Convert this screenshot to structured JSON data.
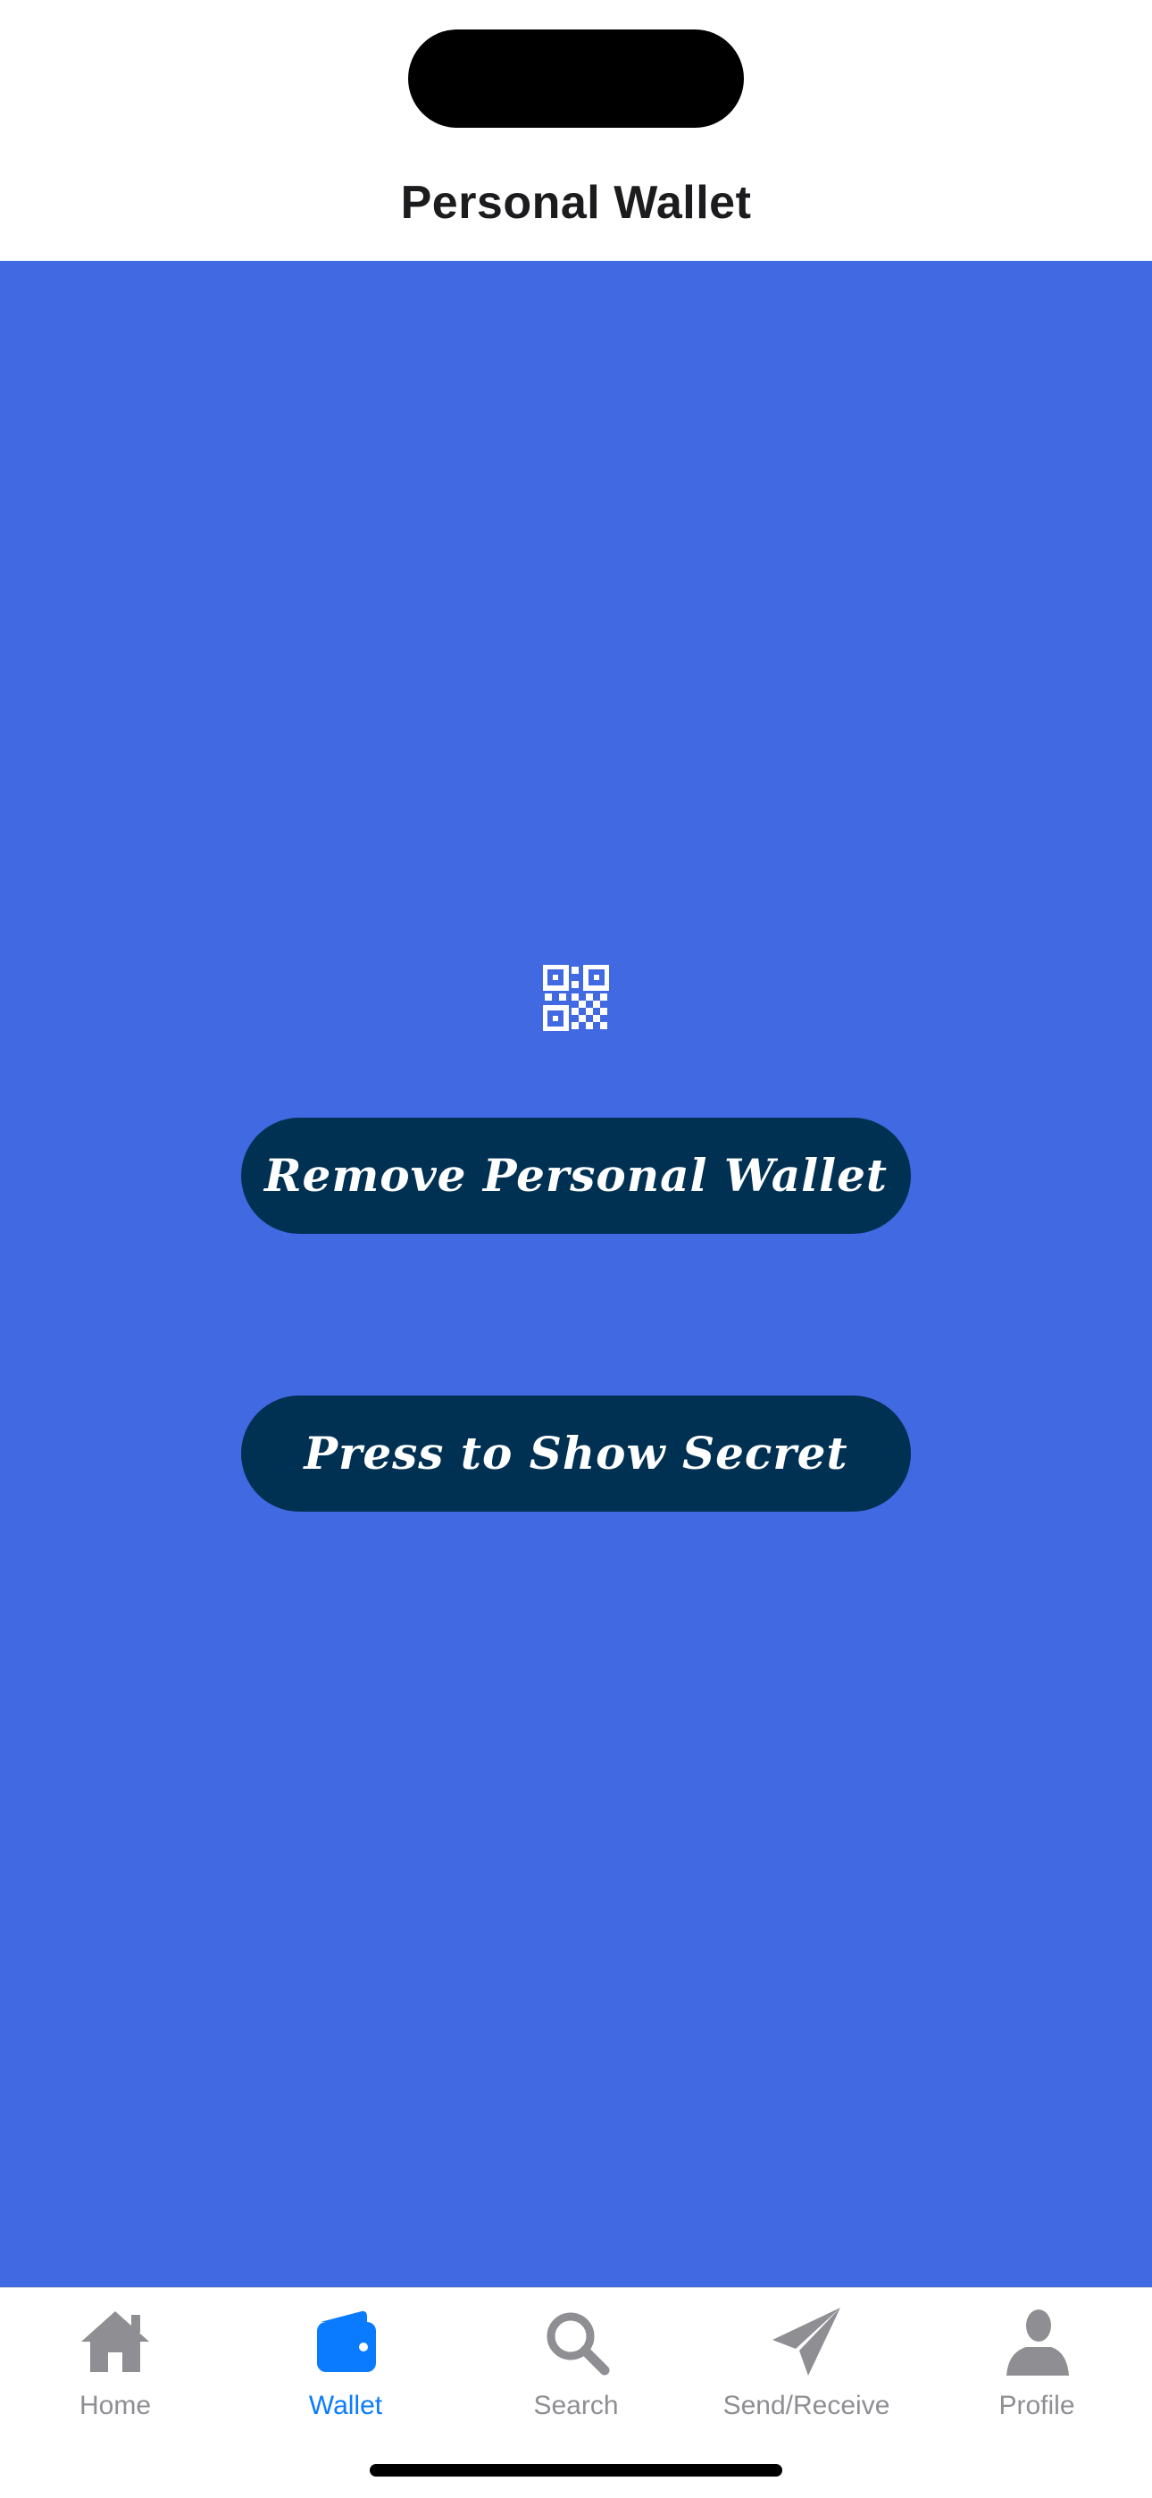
{
  "header": {
    "title": "Personal Wallet"
  },
  "main": {
    "background_color": "#4169e1",
    "qr_icon": "qr-code-icon",
    "buttons": {
      "remove_label": "Remove Personal Wallet",
      "secret_label": "Press to Show Secret",
      "button_color": "#003153"
    }
  },
  "tabbar": {
    "active_color": "#0a7aff",
    "inactive_color": "#8e8e93",
    "items": [
      {
        "label": "Home",
        "icon": "home-icon",
        "active": false
      },
      {
        "label": "Wallet",
        "icon": "wallet-icon",
        "active": true
      },
      {
        "label": "Search",
        "icon": "search-icon",
        "active": false
      },
      {
        "label": "Send/Receive",
        "icon": "paper-plane-icon",
        "active": false
      },
      {
        "label": "Profile",
        "icon": "person-icon",
        "active": false
      }
    ]
  }
}
